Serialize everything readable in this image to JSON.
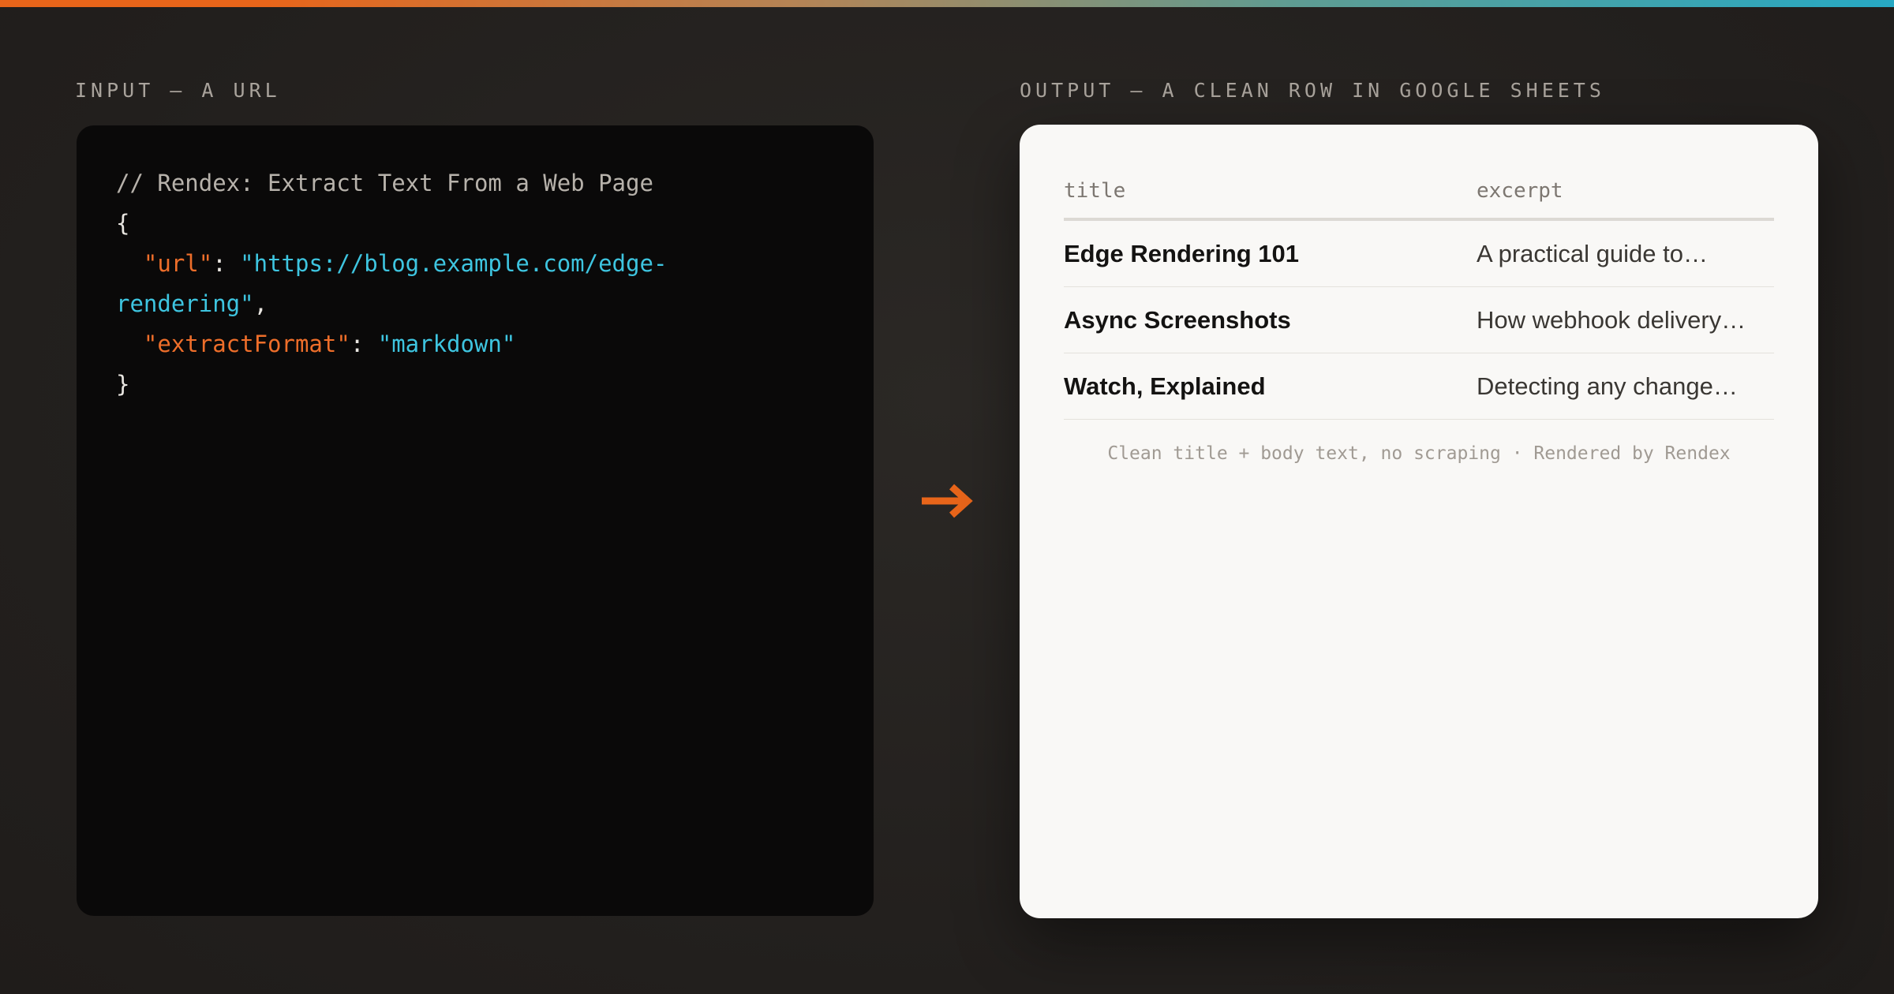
{
  "labels": {
    "input": "INPUT — A URL",
    "output": "OUTPUT — A CLEAN ROW IN GOOGLE SHEETS"
  },
  "code": {
    "comment": "// Rendex: Extract Text From a Web Page",
    "open_brace": "{",
    "url_key": "\"url\"",
    "url_value_line1": "\"https://blog.example.com/edge-",
    "url_value_line2": "rendering\"",
    "format_key": "\"extractFormat\"",
    "format_value": "\"markdown\"",
    "close_brace": "}",
    "colon": ": ",
    "comma": ","
  },
  "icons": {
    "arrow": "arrow-right-icon"
  },
  "sheet": {
    "columns": [
      "title",
      "excerpt"
    ],
    "rows": [
      {
        "title": "Edge Rendering 101",
        "excerpt": "A practical guide to…"
      },
      {
        "title": "Async Screenshots",
        "excerpt": "How webhook delivery…"
      },
      {
        "title": "Watch, Explained",
        "excerpt": "Detecting any change…"
      }
    ],
    "footer": "Clean title + body text, no scraping · Rendered by Rendex"
  },
  "colors": {
    "accent_orange": "#e8651a",
    "accent_cyan": "#27a9c4",
    "code_key": "#ee6e2a",
    "code_string": "#3ec5e0"
  }
}
